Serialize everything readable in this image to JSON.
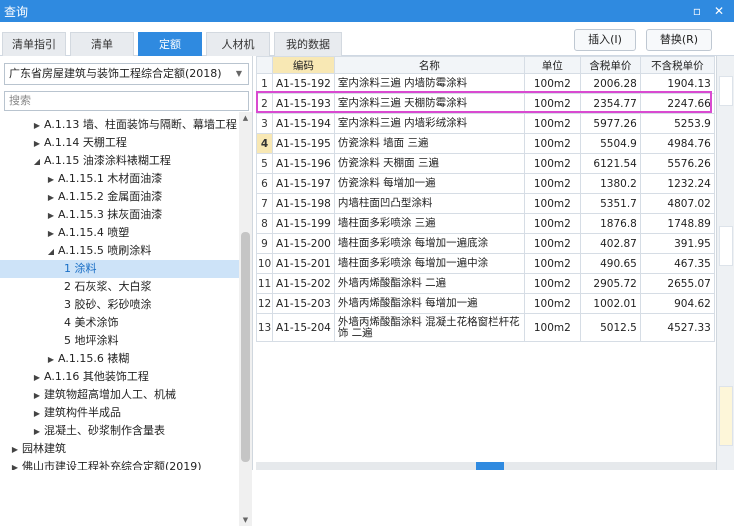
{
  "window": {
    "title": "查询",
    "minimize": "▫",
    "close": "✕"
  },
  "tabs": [
    {
      "label": "清单指引"
    },
    {
      "label": "清单"
    },
    {
      "label": "定额"
    },
    {
      "label": "人材机"
    },
    {
      "label": "我的数据"
    }
  ],
  "buttons": {
    "insert": "插入(I)",
    "replace": "替换(R)"
  },
  "left": {
    "quota_select": "广东省房屋建筑与装饰工程综合定额(2018)",
    "search_placeholder": "搜索",
    "tree": [
      {
        "label": "A.1.13 墙、柱面装饰与隔断、幕墙工程",
        "tri": "▶"
      },
      {
        "label": "A.1.14 天棚工程",
        "tri": "▶"
      },
      {
        "label": "A.1.15 油漆涂料裱糊工程",
        "tri": "◢"
      },
      {
        "label": "A.1.15.1 木材面油漆",
        "tri": "▶"
      },
      {
        "label": "A.1.15.2 金属面油漆",
        "tri": "▶"
      },
      {
        "label": "A.1.15.3 抹灰面油漆",
        "tri": "▶"
      },
      {
        "label": "A.1.15.4 喷塑",
        "tri": "▶"
      },
      {
        "label": "A.1.15.5 喷刷涂料",
        "tri": "◢"
      },
      {
        "label": "1 涂料",
        "tri": ""
      },
      {
        "label": "2 石灰浆、大白浆",
        "tri": ""
      },
      {
        "label": "3 胶砂、彩砂喷涂",
        "tri": ""
      },
      {
        "label": "4 美术涂饰",
        "tri": ""
      },
      {
        "label": "5 地坪涂料",
        "tri": ""
      },
      {
        "label": "A.1.15.6 裱糊",
        "tri": "▶"
      },
      {
        "label": "A.1.16 其他装饰工程",
        "tri": "▶"
      },
      {
        "label": "建筑物超高增加人工、机械",
        "tri": "▶"
      },
      {
        "label": "建筑构件半成品",
        "tri": "▶"
      },
      {
        "label": "混凝土、砂浆制作含量表",
        "tri": "▶"
      },
      {
        "label": "园林建筑",
        "tri": "▶"
      },
      {
        "label": "佛山市建设工程补充综合定额(2019)",
        "tri": "▶"
      }
    ]
  },
  "table": {
    "headers": [
      "编码",
      "名称",
      "单位",
      "含税单价",
      "不含税单价"
    ],
    "rows": [
      {
        "idx": "1",
        "code": "A1-15-192",
        "name": "室内涂料三遍 内墙防霉涂料",
        "unit": "100m2",
        "tax": "2006.28",
        "notax": "1904.13"
      },
      {
        "idx": "2",
        "code": "A1-15-193",
        "name": "室内涂料三遍 天棚防霉涂料",
        "unit": "100m2",
        "tax": "2354.77",
        "notax": "2247.66"
      },
      {
        "idx": "3",
        "code": "A1-15-194",
        "name": "室内涂料三遍 内墙彩绒涂料",
        "unit": "100m2",
        "tax": "5977.26",
        "notax": "5253.9"
      },
      {
        "idx": "4",
        "code": "A1-15-195",
        "name": "仿瓷涂料 墙面 三遍",
        "unit": "100m2",
        "tax": "5504.9",
        "notax": "4984.76"
      },
      {
        "idx": "5",
        "code": "A1-15-196",
        "name": "仿瓷涂料 天棚面 三遍",
        "unit": "100m2",
        "tax": "6121.54",
        "notax": "5576.26"
      },
      {
        "idx": "6",
        "code": "A1-15-197",
        "name": "仿瓷涂料 每增加一遍",
        "unit": "100m2",
        "tax": "1380.2",
        "notax": "1232.24"
      },
      {
        "idx": "7",
        "code": "A1-15-198",
        "name": "内墙柱面凹凸型涂料",
        "unit": "100m2",
        "tax": "5351.7",
        "notax": "4807.02"
      },
      {
        "idx": "8",
        "code": "A1-15-199",
        "name": "墙柱面多彩喷涂 三遍",
        "unit": "100m2",
        "tax": "1876.8",
        "notax": "1748.89"
      },
      {
        "idx": "9",
        "code": "A1-15-200",
        "name": "墙柱面多彩喷涂 每增加一遍底涂",
        "unit": "100m2",
        "tax": "402.87",
        "notax": "391.95"
      },
      {
        "idx": "10",
        "code": "A1-15-201",
        "name": "墙柱面多彩喷涂 每增加一遍中涂",
        "unit": "100m2",
        "tax": "490.65",
        "notax": "467.35"
      },
      {
        "idx": "11",
        "code": "A1-15-202",
        "name": "外墙丙烯酸酯涂料 二遍",
        "unit": "100m2",
        "tax": "2905.72",
        "notax": "2655.07"
      },
      {
        "idx": "12",
        "code": "A1-15-203",
        "name": "外墙丙烯酸酯涂料 每增加一遍",
        "unit": "100m2",
        "tax": "1002.01",
        "notax": "904.62"
      },
      {
        "idx": "13",
        "code": "A1-15-204",
        "name": "外墙丙烯酸酯涂料 混凝土花格窗栏杆花饰 二遍",
        "unit": "100m2",
        "tax": "5012.5",
        "notax": "4527.33"
      }
    ]
  },
  "colors": {
    "accent": "#2f8ae0",
    "highlight": "#d94ad0",
    "header_code": "#f8e8b4"
  }
}
